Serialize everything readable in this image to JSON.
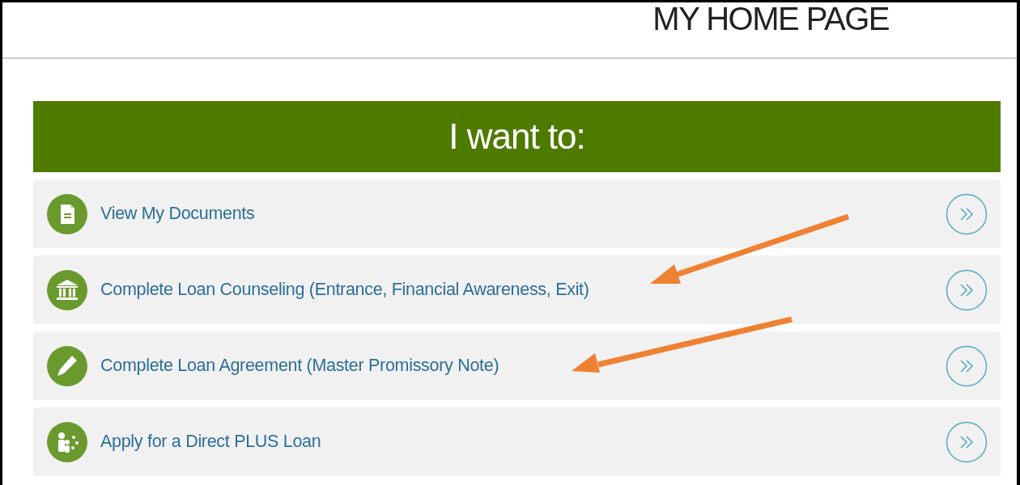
{
  "page_title": "MY HOME PAGE",
  "panel": {
    "heading": "I want to:",
    "items": [
      {
        "kind": "document",
        "label": "View My Documents",
        "arrow": false
      },
      {
        "kind": "bank",
        "label": "Complete Loan Counseling (Entrance, Financial Awareness, Exit)",
        "arrow": true
      },
      {
        "kind": "pencil",
        "label": "Complete Loan Agreement (Master Promissory Note)",
        "arrow": true
      },
      {
        "kind": "family",
        "label": "Apply for a Direct PLUS Loan",
        "arrow": false
      }
    ]
  }
}
